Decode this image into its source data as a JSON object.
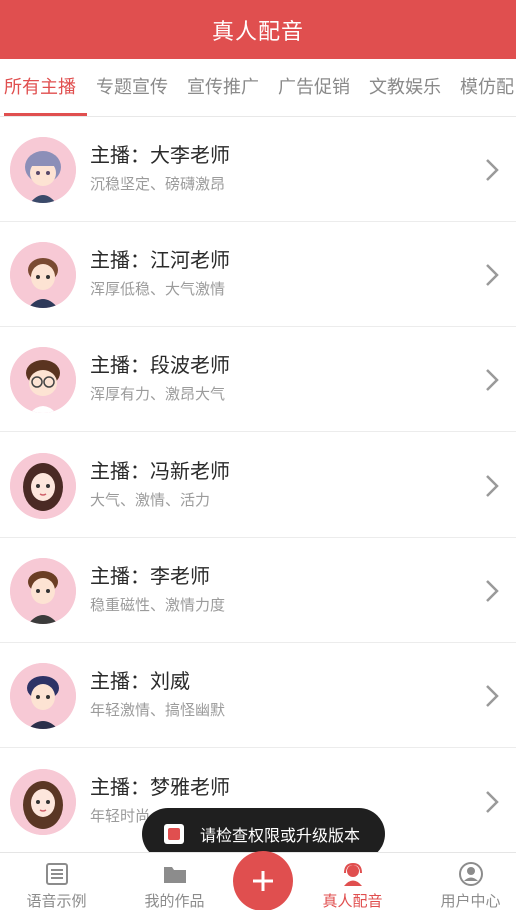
{
  "header": {
    "title": "真人配音"
  },
  "tabs": [
    {
      "label": "所有主播",
      "active": true
    },
    {
      "label": "专题宣传",
      "active": false
    },
    {
      "label": "宣传推广",
      "active": false
    },
    {
      "label": "广告促销",
      "active": false
    },
    {
      "label": "文教娱乐",
      "active": false
    },
    {
      "label": "模仿配",
      "active": false
    }
  ],
  "anchors": [
    {
      "name": "主播：大李老师",
      "desc": "沉稳坚定、磅礴激昂",
      "avatar_icon": "avatar-icon"
    },
    {
      "name": "主播：江河老师",
      "desc": "浑厚低稳、大气激情",
      "avatar_icon": "avatar-icon"
    },
    {
      "name": "主播：段波老师",
      "desc": "浑厚有力、激昂大气",
      "avatar_icon": "avatar-icon"
    },
    {
      "name": "主播：冯新老师",
      "desc": "大气、激情、活力",
      "avatar_icon": "avatar-icon"
    },
    {
      "name": "主播：李老师",
      "desc": "稳重磁性、激情力度",
      "avatar_icon": "avatar-icon"
    },
    {
      "name": "主播：刘威",
      "desc": "年轻激情、搞怪幽默",
      "avatar_icon": "avatar-icon"
    },
    {
      "name": "主播：梦雅老师",
      "desc": "年轻时尚",
      "avatar_icon": "avatar-icon"
    }
  ],
  "toast": {
    "message": "请检查权限或升级版本"
  },
  "tabbar": {
    "items": [
      {
        "label": "语音示例",
        "icon": "list-icon"
      },
      {
        "label": "我的作品",
        "icon": "folder-icon"
      },
      {
        "label": "真人配音",
        "icon": "headset-icon",
        "active": true
      },
      {
        "label": "用户中心",
        "icon": "user-icon"
      }
    ],
    "add_icon": "plus-icon"
  },
  "colors": {
    "accent": "#e04f4f",
    "avatar_bg": "#f7c9d5"
  }
}
